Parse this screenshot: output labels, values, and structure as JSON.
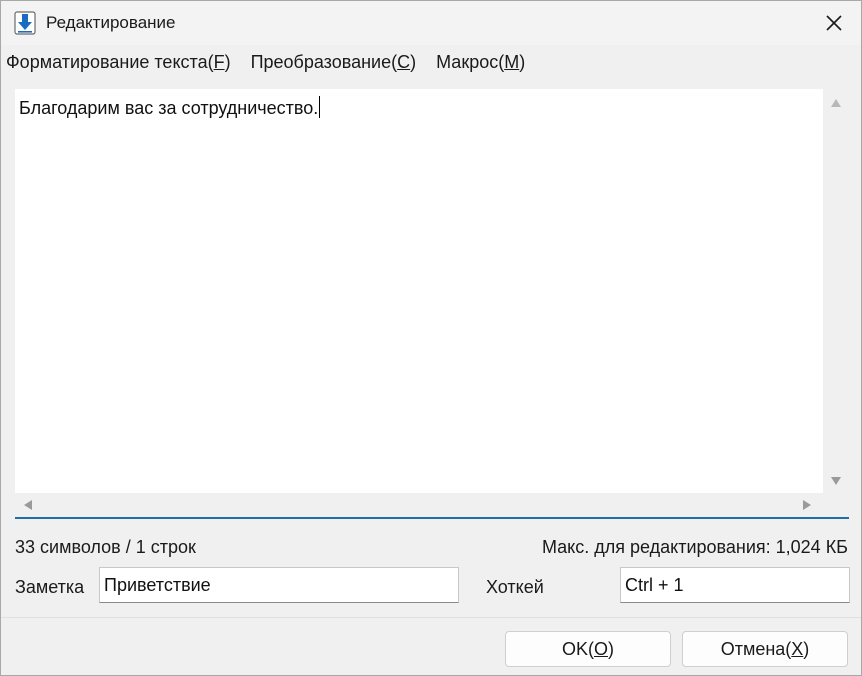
{
  "window": {
    "title": "Редактирование",
    "icon": "download-arrow-icon"
  },
  "menu": [
    {
      "text": "Форматирование текста(",
      "key": "F",
      "suffix": ")"
    },
    {
      "text": "Преобразование(",
      "key": "C",
      "suffix": ")"
    },
    {
      "text": "Макрос(",
      "key": "M",
      "suffix": ")"
    }
  ],
  "editor": {
    "content": "Благодарим вас за сотрудничество."
  },
  "status": {
    "counts": "33 символов / 1 строк",
    "max_size": "Макс. для редактирования: 1,024 КБ"
  },
  "note": {
    "label": "Заметка",
    "value": "Приветствие"
  },
  "hotkey": {
    "label": "Хоткей",
    "value": "Ctrl + 1"
  },
  "buttons": {
    "ok": {
      "text": "OK(",
      "key": "O",
      "suffix": ")"
    },
    "cancel": {
      "text": "Отмена(",
      "key": "X",
      "suffix": ")"
    }
  },
  "colors": {
    "accent": "#1f6fa8",
    "icon_blue": "#1a6cc0"
  }
}
